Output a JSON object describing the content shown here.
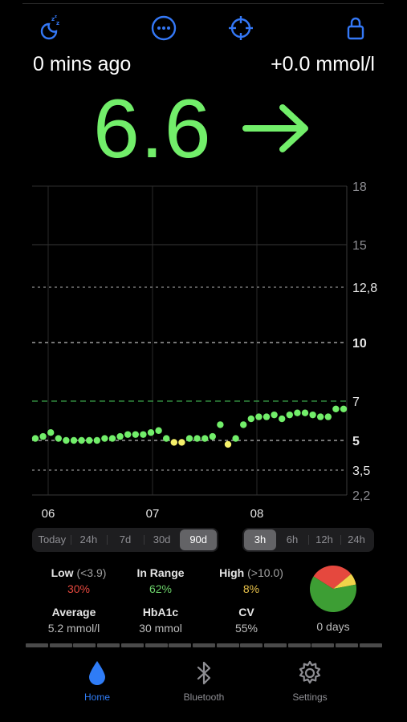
{
  "header": {
    "icons": [
      "sleep-icon",
      "more-icon",
      "crosshair-icon",
      "lock-icon"
    ],
    "accent_color": "#3478f6"
  },
  "status": {
    "last_update": "0 mins ago",
    "delta": "+0.0 mmol/l"
  },
  "reading": {
    "value": "6.6",
    "trend": "flat-arrow-right",
    "color": "#72ee6a"
  },
  "chart_data": {
    "type": "scatter",
    "title": "",
    "xlabel": "",
    "ylabel": "",
    "y_tick_labels": [
      "18",
      "15",
      "12,8",
      "10",
      "7",
      "5",
      "3,5",
      "2,2"
    ],
    "x_tick_labels": [
      "06",
      "07",
      "08"
    ],
    "ylim": [
      2.2,
      18
    ],
    "target_range": {
      "low": 5,
      "high": 7
    },
    "grid": true,
    "colors": {
      "in_range": "#72ee6a",
      "low": "#f5f06a",
      "target_line": "#3ba34a"
    },
    "points": [
      {
        "t": 0.0,
        "v": 5.1
      },
      {
        "t": 0.5,
        "v": 5.2
      },
      {
        "t": 1.0,
        "v": 5.4
      },
      {
        "t": 1.5,
        "v": 5.1
      },
      {
        "t": 2.0,
        "v": 5.0
      },
      {
        "t": 2.5,
        "v": 5.0
      },
      {
        "t": 3.0,
        "v": 5.0
      },
      {
        "t": 3.5,
        "v": 5.0
      },
      {
        "t": 4.0,
        "v": 5.0
      },
      {
        "t": 4.5,
        "v": 5.1
      },
      {
        "t": 5.0,
        "v": 5.1
      },
      {
        "t": 5.5,
        "v": 5.2
      },
      {
        "t": 6.0,
        "v": 5.3
      },
      {
        "t": 6.5,
        "v": 5.3
      },
      {
        "t": 7.0,
        "v": 5.3
      },
      {
        "t": 7.5,
        "v": 5.4
      },
      {
        "t": 8.0,
        "v": 5.5
      },
      {
        "t": 8.5,
        "v": 5.1
      },
      {
        "t": 9.0,
        "v": 4.9
      },
      {
        "t": 9.5,
        "v": 4.9
      },
      {
        "t": 10.0,
        "v": 5.1
      },
      {
        "t": 10.5,
        "v": 5.1
      },
      {
        "t": 11.0,
        "v": 5.1
      },
      {
        "t": 11.5,
        "v": 5.2
      },
      {
        "t": 12.0,
        "v": 5.8
      },
      {
        "t": 12.5,
        "v": 4.8
      },
      {
        "t": 13.0,
        "v": 5.1
      },
      {
        "t": 13.5,
        "v": 5.8
      },
      {
        "t": 14.0,
        "v": 6.1
      },
      {
        "t": 14.5,
        "v": 6.2
      },
      {
        "t": 15.0,
        "v": 6.2
      },
      {
        "t": 15.5,
        "v": 6.3
      },
      {
        "t": 16.0,
        "v": 6.1
      },
      {
        "t": 16.5,
        "v": 6.3
      },
      {
        "t": 17.0,
        "v": 6.4
      },
      {
        "t": 17.5,
        "v": 6.4
      },
      {
        "t": 18.0,
        "v": 6.3
      },
      {
        "t": 18.5,
        "v": 6.2
      },
      {
        "t": 19.0,
        "v": 6.2
      },
      {
        "t": 19.5,
        "v": 6.6
      },
      {
        "t": 20.0,
        "v": 6.6
      }
    ],
    "low_points_t": [
      9.0,
      9.5,
      12.5
    ]
  },
  "ranges": {
    "left": [
      "Today",
      "24h",
      "7d",
      "30d",
      "90d"
    ],
    "left_selected": 4,
    "right": [
      "3h",
      "6h",
      "12h",
      "24h"
    ],
    "right_selected": 0
  },
  "stats": {
    "low": {
      "label": "Low",
      "sub": "(<3.9)",
      "value": "30%",
      "color": "#e5483e"
    },
    "in_range": {
      "label": "In Range",
      "value": "62%",
      "color": "#6cd26a"
    },
    "high": {
      "label": "High",
      "sub": "(>10.0)",
      "value": "8%",
      "color": "#e9c24a"
    },
    "average": {
      "label": "Average",
      "value": "5.2 mmol/l"
    },
    "hba1c": {
      "label": "HbA1c",
      "value": "30 mmol"
    },
    "cv": {
      "label": "CV",
      "value": "55%"
    },
    "days": "0 days",
    "pie": [
      {
        "name": "Low",
        "fraction": 0.3,
        "color": "#e5483e"
      },
      {
        "name": "High",
        "fraction": 0.08,
        "color": "#f0d34a"
      },
      {
        "name": "In Range",
        "fraction": 0.62,
        "color": "#3d9e34"
      }
    ]
  },
  "tabs": [
    {
      "label": "Home",
      "icon": "drop-icon",
      "active": true
    },
    {
      "label": "Bluetooth",
      "icon": "bluetooth-icon",
      "active": false
    },
    {
      "label": "Settings",
      "icon": "gear-icon",
      "active": false
    }
  ]
}
